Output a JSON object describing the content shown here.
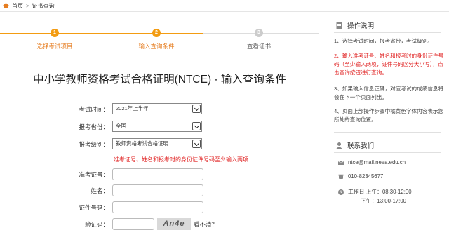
{
  "breadcrumb": {
    "home": "首页",
    "separator": ">",
    "current": "证书查询"
  },
  "steps": [
    {
      "num": "1",
      "label": "选择考试项目",
      "state": "active"
    },
    {
      "num": "2",
      "label": "输入查询条件",
      "state": "active"
    },
    {
      "num": "3",
      "label": "查看证书",
      "state": "inactive"
    }
  ],
  "colors": {
    "accent": "#f39c12",
    "accent_text": "#e67e22",
    "error": "#e02020"
  },
  "form": {
    "title": "中小学教师资格考试合格证明(NTCE) - 输入查询条件",
    "exam_time": {
      "label": "考试时间：",
      "value": "2021年上半年"
    },
    "province": {
      "label": "报考省份：",
      "value": "全国"
    },
    "level": {
      "label": "报考级别：",
      "value": "教师资格考试合格证明"
    },
    "hint": "准考证号、姓名和报考时的身份证件号码至少输入两项",
    "ticket": {
      "label": "准考证号："
    },
    "name": {
      "label": "姓名："
    },
    "id_number": {
      "label": "证件号码："
    },
    "captcha": {
      "label": "验证码：",
      "image_text": "An4e",
      "refresh_link": "看不清？"
    }
  },
  "sidebar": {
    "instructions_title": "操作说明",
    "instructions": [
      {
        "text": "1、选择考试时间，报考省份，考试级别。",
        "highlight": false
      },
      {
        "text": "2、输入准考证号、姓名和报考时的身份证件号码（至少输入两项，证件号码区分大小写），点击查询按钮进行查询。",
        "highlight": true
      },
      {
        "text": "3、如果输入信息正确，对应考试的成绩信息将会在下一个页面列出。",
        "highlight": false
      },
      {
        "text": "4、页面上部操作步骤中橘黄色字体内容表示您所处的查询位置。",
        "highlight": false
      }
    ],
    "contact_title": "联系我们",
    "email": "ntce@mail.neea.edu.cn",
    "phone": "010-82345677",
    "hours_am": "工作日 上午：08:30-12:00",
    "hours_pm": "下午：13:00-17:00"
  }
}
